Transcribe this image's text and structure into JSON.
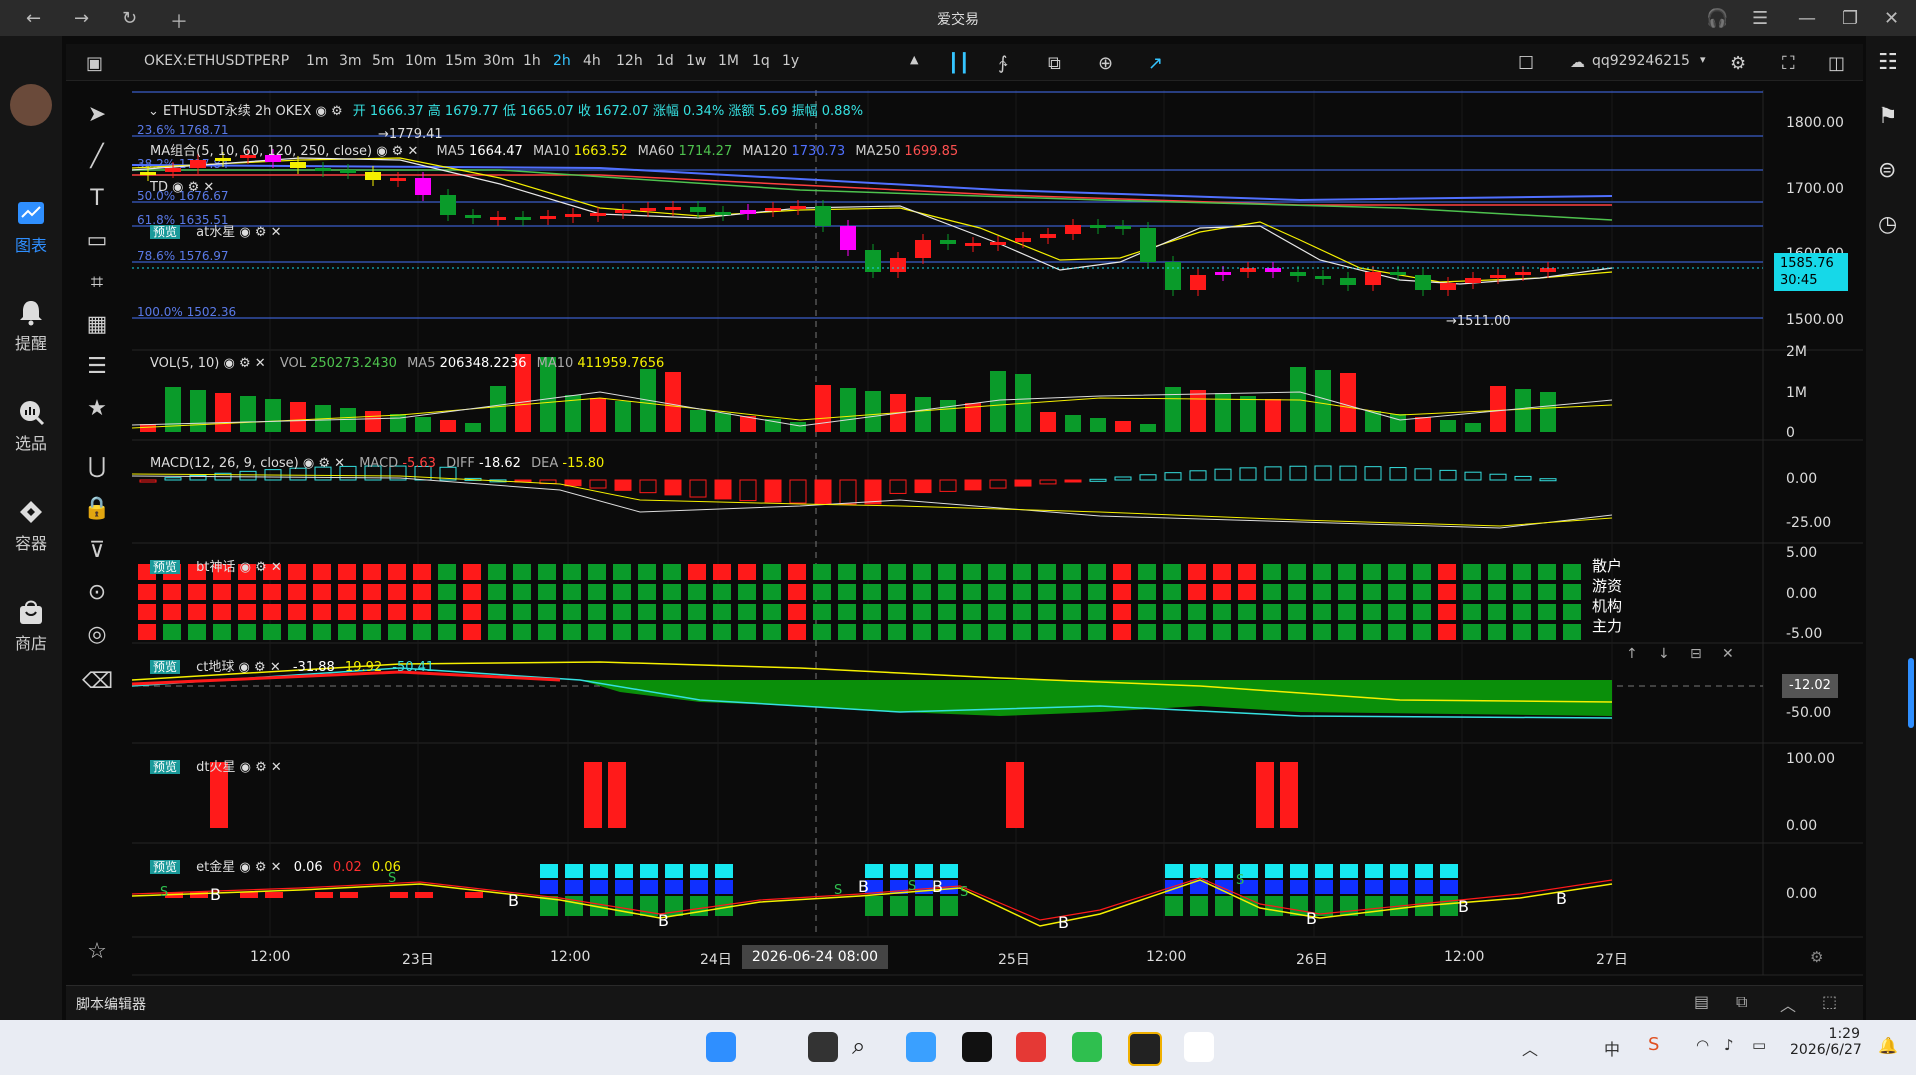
{
  "window": {
    "title": "爱交易"
  },
  "app_nav": {
    "items": [
      {
        "label": "图表",
        "active": true
      },
      {
        "label": "提醒"
      },
      {
        "label": "选品"
      },
      {
        "label": "容器"
      },
      {
        "label": "商店"
      }
    ]
  },
  "toolbar": {
    "symbol": "OKEX:ETHUSDTPERP",
    "timeframes": [
      "1m",
      "3m",
      "5m",
      "10m",
      "15m",
      "30m",
      "1h",
      "2h",
      "4h",
      "12h",
      "1d",
      "1w",
      "1M",
      "1q",
      "1y"
    ],
    "active_timeframe": "2h",
    "user": "qq929246215"
  },
  "main_pane": {
    "symbol_line": "ETHUSDT永续  2h  OKEX",
    "ohlc_text": "开 1666.37 高 1679.77 低 1665.07 收 1672.07 涨幅 0.34% 涨额 5.69 振幅 0.88%",
    "ma_label": "MA组合",
    "ma_params": "(5, 10, 60, 120, 250, close)",
    "ma5": {
      "label": "MA5",
      "value": "1664.47"
    },
    "ma10": {
      "label": "MA10",
      "value": "1663.52"
    },
    "ma60": {
      "label": "MA60",
      "value": "1714.27"
    },
    "ma120": {
      "label": "MA120",
      "value": "1730.73"
    },
    "ma250": {
      "label": "MA250",
      "value": "1699.85"
    },
    "td_label": "TD",
    "at_label": "at水星",
    "preview_badge": "预览",
    "fib_levels": [
      "23.6% 1768.71",
      "38.2% 1717.84",
      "50.0% 1676.67",
      "61.8% 1635.51",
      "78.6% 1576.97",
      "100.0% 1502.36"
    ],
    "high_marker": "1779.41",
    "low_marker": "1511.00",
    "y_ticks": [
      "1800.00",
      "1700.00",
      "1600.00",
      "1500.00"
    ],
    "last_price": "1585.76",
    "countdown": "30:45"
  },
  "vol_pane": {
    "label": "VOL",
    "params": "(5, 10)",
    "vol": {
      "label": "VOL",
      "value": "250273.2430"
    },
    "ma5": {
      "label": "MA5",
      "value": "206348.2236"
    },
    "ma10": {
      "label": "MA10",
      "value": "411959.7656"
    },
    "y_ticks": [
      "2M",
      "1M",
      "0"
    ]
  },
  "macd_pane": {
    "label": "MACD",
    "params": "(12, 26, 9, close)",
    "macd": {
      "label": "MACD",
      "value": "-5.63"
    },
    "diff": {
      "label": "DIFF",
      "value": "-18.62"
    },
    "dea": {
      "label": "DEA",
      "value": "-15.80"
    },
    "y_ticks": [
      "0.00",
      "-25.00"
    ]
  },
  "bt_pane": {
    "label": "bt神话",
    "row_labels": [
      "散户",
      "游资",
      "机构",
      "主力"
    ],
    "y_ticks": [
      "5.00",
      "0.00",
      "-5.00"
    ]
  },
  "ct_pane": {
    "label": "ct地球",
    "v1": "-31.88",
    "v2": "19.92",
    "v3": "-50.41",
    "current": "-12.02",
    "y_ticks": [
      "0.00",
      "-50.00"
    ]
  },
  "dt_pane": {
    "label": "dt火星",
    "y_ticks": [
      "100.00",
      "0.00"
    ]
  },
  "et_pane": {
    "label": "et金星",
    "v1": "0.06",
    "v2": "0.02",
    "v3": "0.06",
    "y_ticks": [
      "0.00"
    ],
    "b_marker": "B",
    "s_marker": "S"
  },
  "x_axis": {
    "ticks": [
      "12:00",
      "23日",
      "12:00",
      "24日",
      "25日",
      "12:00",
      "26日",
      "12:00",
      "27日"
    ],
    "crosshair_label": "2026-06-24  08:00"
  },
  "editor": {
    "label": "脚本编辑器"
  },
  "taskbar": {
    "time": "1:29",
    "date": "2026/6/27"
  },
  "colors": {
    "up": "#ff1a1a",
    "down": "#0a9b2a",
    "accent": "#35c5ff",
    "magenta": "#ff00ff",
    "yellow": "#f5f000"
  }
}
